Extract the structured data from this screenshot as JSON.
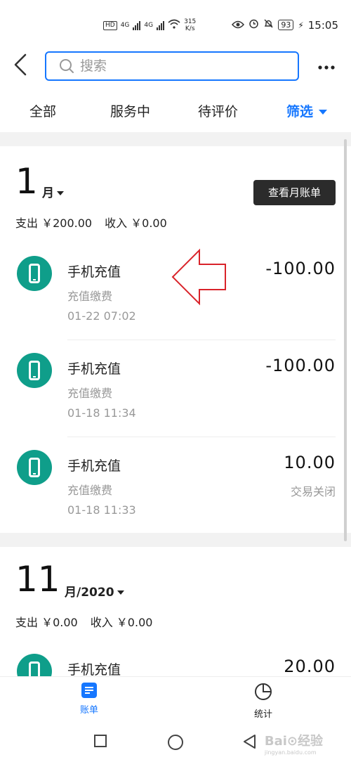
{
  "status_bar": {
    "chips": [
      "HD",
      "4G",
      "4G"
    ],
    "speed": "315\nK/s",
    "battery": "93",
    "time": "15:05"
  },
  "header": {
    "search_placeholder": "搜索"
  },
  "tabs": [
    {
      "label": "全部"
    },
    {
      "label": "服务中"
    },
    {
      "label": "待评价"
    },
    {
      "label": "筛选"
    }
  ],
  "month_bill_button": "查看月账单",
  "sections": [
    {
      "month_number": "1",
      "month_unit": "月",
      "summary_expense": "支出 ￥200.00",
      "summary_income": "收入 ￥0.00",
      "transactions": [
        {
          "title": "手机充值",
          "category": "充值缴费",
          "time": "01-22  07:02",
          "amount": "-100.00",
          "status": ""
        },
        {
          "title": "手机充值",
          "category": "充值缴费",
          "time": "01-18  11:34",
          "amount": "-100.00",
          "status": ""
        },
        {
          "title": "手机充值",
          "category": "充值缴费",
          "time": "01-18  11:33",
          "amount": "10.00",
          "status": "交易关闭"
        }
      ]
    },
    {
      "month_number": "11",
      "month_unit": "月/2020",
      "summary_expense": "支出 ￥0.00",
      "summary_income": "收入 ￥0.00",
      "transactions": [
        {
          "title": "手机充值",
          "amount": "20.00"
        }
      ]
    }
  ],
  "bottom_nav": [
    {
      "label": "账单"
    },
    {
      "label": "统计"
    }
  ],
  "watermark": {
    "brand": "Bai⊙经验",
    "url": "jingyan.baidu.com"
  },
  "colors": {
    "accent": "#1677ff",
    "icon_bg": "#0f9e8a",
    "annotation": "#d9232a"
  }
}
